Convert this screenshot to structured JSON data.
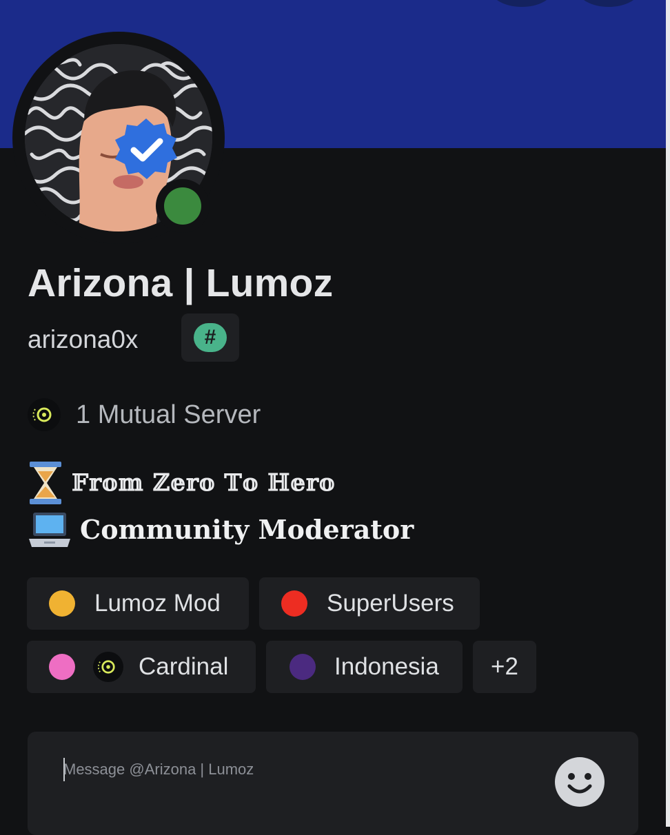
{
  "profile": {
    "display_name": "Arizona | Lumoz",
    "username": "arizona0x",
    "tag_symbol": "#",
    "mutual_servers": "1 Mutual Server",
    "status": "online"
  },
  "bio": [
    {
      "emoji": "⌛",
      "text": "𝔽𝕣𝕠𝕞 ℤ𝕖𝕣𝕠 𝕋𝕠 ℍ𝕖𝕣𝕠"
    },
    {
      "emoji": "💻",
      "text": "𝐂𝐨𝐦𝐦𝐮𝐧𝐢𝐭𝐲 𝐌𝐨𝐝𝐞𝐫𝐚𝐭𝐨𝐫"
    }
  ],
  "roles": [
    {
      "label": "Lumoz Mod",
      "color": "#f0b232"
    },
    {
      "label": "SuperUsers",
      "color": "#ed2d22"
    },
    {
      "label": "Cardinal",
      "color": "#ee6ec3"
    },
    {
      "label": "Indonesia",
      "color": "#4b2a80"
    },
    {
      "label": "+2"
    }
  ],
  "composer": {
    "placeholder": "Message @Arizona | Lumoz"
  },
  "colors": {
    "banner": "#1b2b8a",
    "background": "#111214",
    "status_online": "#3b8a3e",
    "verified_badge": "#2f6fde",
    "tag_badge": "#49b38a"
  },
  "icons": {
    "verified": "verified-check-icon",
    "status": "online-status-icon",
    "server": "server-icon",
    "hourglass": "hourglass-icon",
    "laptop": "laptop-icon",
    "emoji": "emoji-smile-icon"
  }
}
